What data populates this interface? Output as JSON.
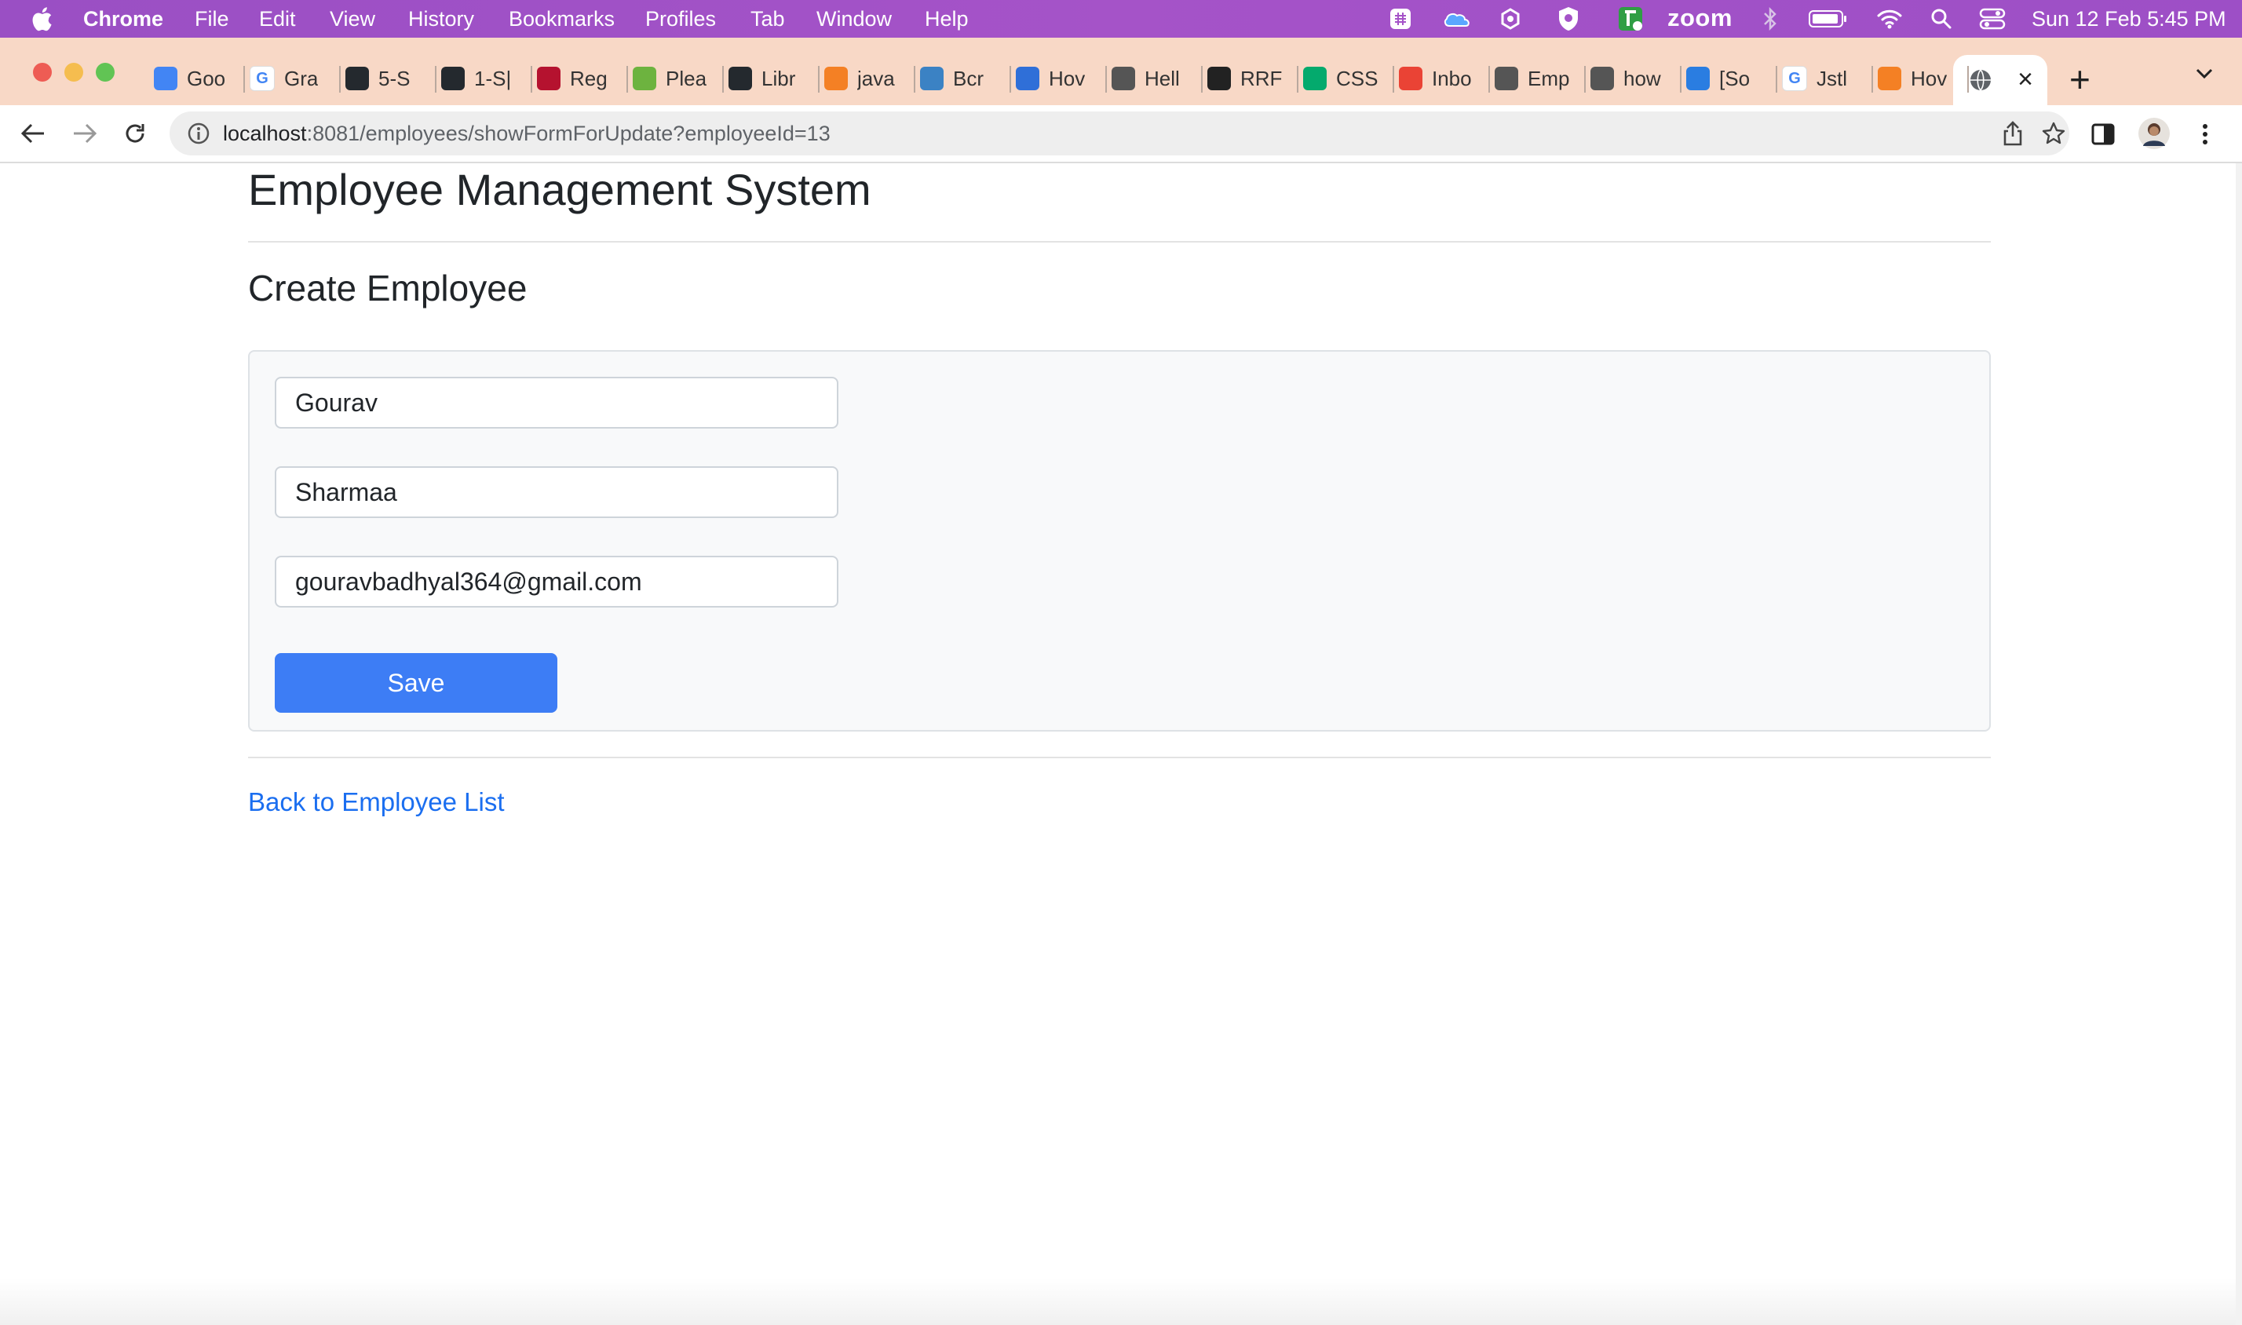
{
  "menubar": {
    "app": "Chrome",
    "items": [
      "File",
      "Edit",
      "View",
      "History",
      "Bookmarks",
      "Profiles",
      "Tab",
      "Window",
      "Help"
    ],
    "zoom_label": "zoom",
    "clock": "Sun 12 Feb  5:45 PM",
    "status_icons": [
      "grid-icon",
      "cloud-icon",
      "settings-icon",
      "shield-icon",
      "app-icon",
      "bluetooth-icon",
      "battery-icon",
      "wifi-icon",
      "spotlight-icon",
      "control-center-icon"
    ]
  },
  "tabs": [
    {
      "label": "Goo",
      "icon": "calendar-icon",
      "color": "#4285f4"
    },
    {
      "label": "Gra",
      "icon": "google-icon",
      "color": "#ffffff"
    },
    {
      "label": "5-S",
      "icon": "github-icon",
      "color": "#24292e"
    },
    {
      "label": "1-S|",
      "icon": "github-icon",
      "color": "#24292e"
    },
    {
      "label": "Reg",
      "icon": "ij-icon",
      "color": "#b5122f"
    },
    {
      "label": "Plea",
      "icon": "leaf-icon",
      "color": "#6db33f"
    },
    {
      "label": "Libr",
      "icon": "github-icon",
      "color": "#24292e"
    },
    {
      "label": "java",
      "icon": "stackoverflow-icon",
      "color": "#f48024"
    },
    {
      "label": "Bcr",
      "icon": "b-icon",
      "color": "#3b82c4"
    },
    {
      "label": "Hov",
      "icon": "swirl-icon",
      "color": "#2f6fd8"
    },
    {
      "label": "Hell",
      "icon": "globe-icon",
      "color": "#555555"
    },
    {
      "label": "RRF",
      "icon": "wikipedia-icon",
      "color": "#222222"
    },
    {
      "label": "CSS",
      "icon": "w3schools-icon",
      "color": "#04aa6d"
    },
    {
      "label": "Inbo",
      "icon": "gmail-icon",
      "color": "#ea4335"
    },
    {
      "label": "Emp",
      "icon": "globe-icon",
      "color": "#555555"
    },
    {
      "label": "how",
      "icon": "globe-icon",
      "color": "#555555"
    },
    {
      "label": "[So",
      "icon": "a-icon",
      "color": "#2a7de1"
    },
    {
      "label": "Jstl",
      "icon": "google-icon",
      "color": "#ffffff"
    },
    {
      "label": "Hov",
      "icon": "stackoverflow-icon",
      "color": "#f48024"
    }
  ],
  "active_tab": {
    "icon": "globe-icon",
    "close": "×"
  },
  "toolbar": {
    "url_host": "localhost",
    "url_rest": ":8081/employees/showFormForUpdate?employeeId=13"
  },
  "page": {
    "title": "Employee Management System",
    "subtitle": "Create Employee",
    "form": {
      "first_name": "Gourav",
      "last_name": "Sharmaa",
      "email": "gouravbadhyal364@gmail.com",
      "save_label": "Save"
    },
    "back_link": "Back to Employee List"
  },
  "colors": {
    "menubar": "#a553c8",
    "tabstrip": "#f8d8c6",
    "primary_button": "#3d7df5",
    "link": "#1a6ef0"
  }
}
